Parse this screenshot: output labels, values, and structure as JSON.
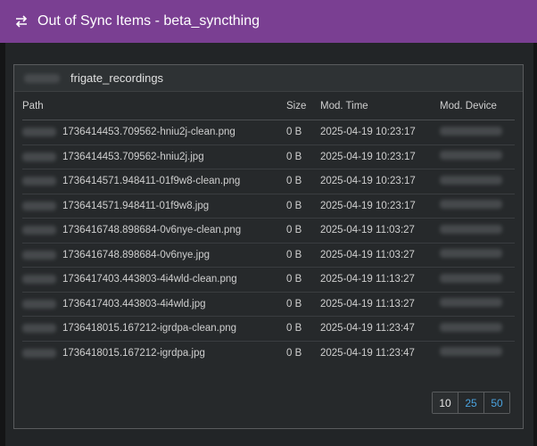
{
  "modal": {
    "title": "Out of Sync Items - beta_syncthing",
    "icon": "exchange-arrows-icon"
  },
  "panel": {
    "folder_name": "frigate_recordings"
  },
  "table": {
    "headers": {
      "path": "Path",
      "size": "Size",
      "mod_time": "Mod. Time",
      "mod_device": "Mod. Device"
    },
    "rows": [
      {
        "path": "1736414453.709562-hniu2j-clean.png",
        "size": "0 B",
        "mod_time": "2025-04-19 10:23:17"
      },
      {
        "path": "1736414453.709562-hniu2j.jpg",
        "size": "0 B",
        "mod_time": "2025-04-19 10:23:17"
      },
      {
        "path": "1736414571.948411-01f9w8-clean.png",
        "size": "0 B",
        "mod_time": "2025-04-19 10:23:17"
      },
      {
        "path": "1736414571.948411-01f9w8.jpg",
        "size": "0 B",
        "mod_time": "2025-04-19 10:23:17"
      },
      {
        "path": "1736416748.898684-0v6nye-clean.png",
        "size": "0 B",
        "mod_time": "2025-04-19 11:03:27"
      },
      {
        "path": "1736416748.898684-0v6nye.jpg",
        "size": "0 B",
        "mod_time": "2025-04-19 11:03:27"
      },
      {
        "path": "1736417403.443803-4i4wld-clean.png",
        "size": "0 B",
        "mod_time": "2025-04-19 11:13:27"
      },
      {
        "path": "1736417403.443803-4i4wld.jpg",
        "size": "0 B",
        "mod_time": "2025-04-19 11:13:27"
      },
      {
        "path": "1736418015.167212-igrdpa-clean.png",
        "size": "0 B",
        "mod_time": "2025-04-19 11:23:47"
      },
      {
        "path": "1736418015.167212-igrdpa.jpg",
        "size": "0 B",
        "mod_time": "2025-04-19 11:23:47"
      }
    ]
  },
  "pagination": {
    "options": [
      "10",
      "25",
      "50"
    ],
    "selected": "10"
  }
}
